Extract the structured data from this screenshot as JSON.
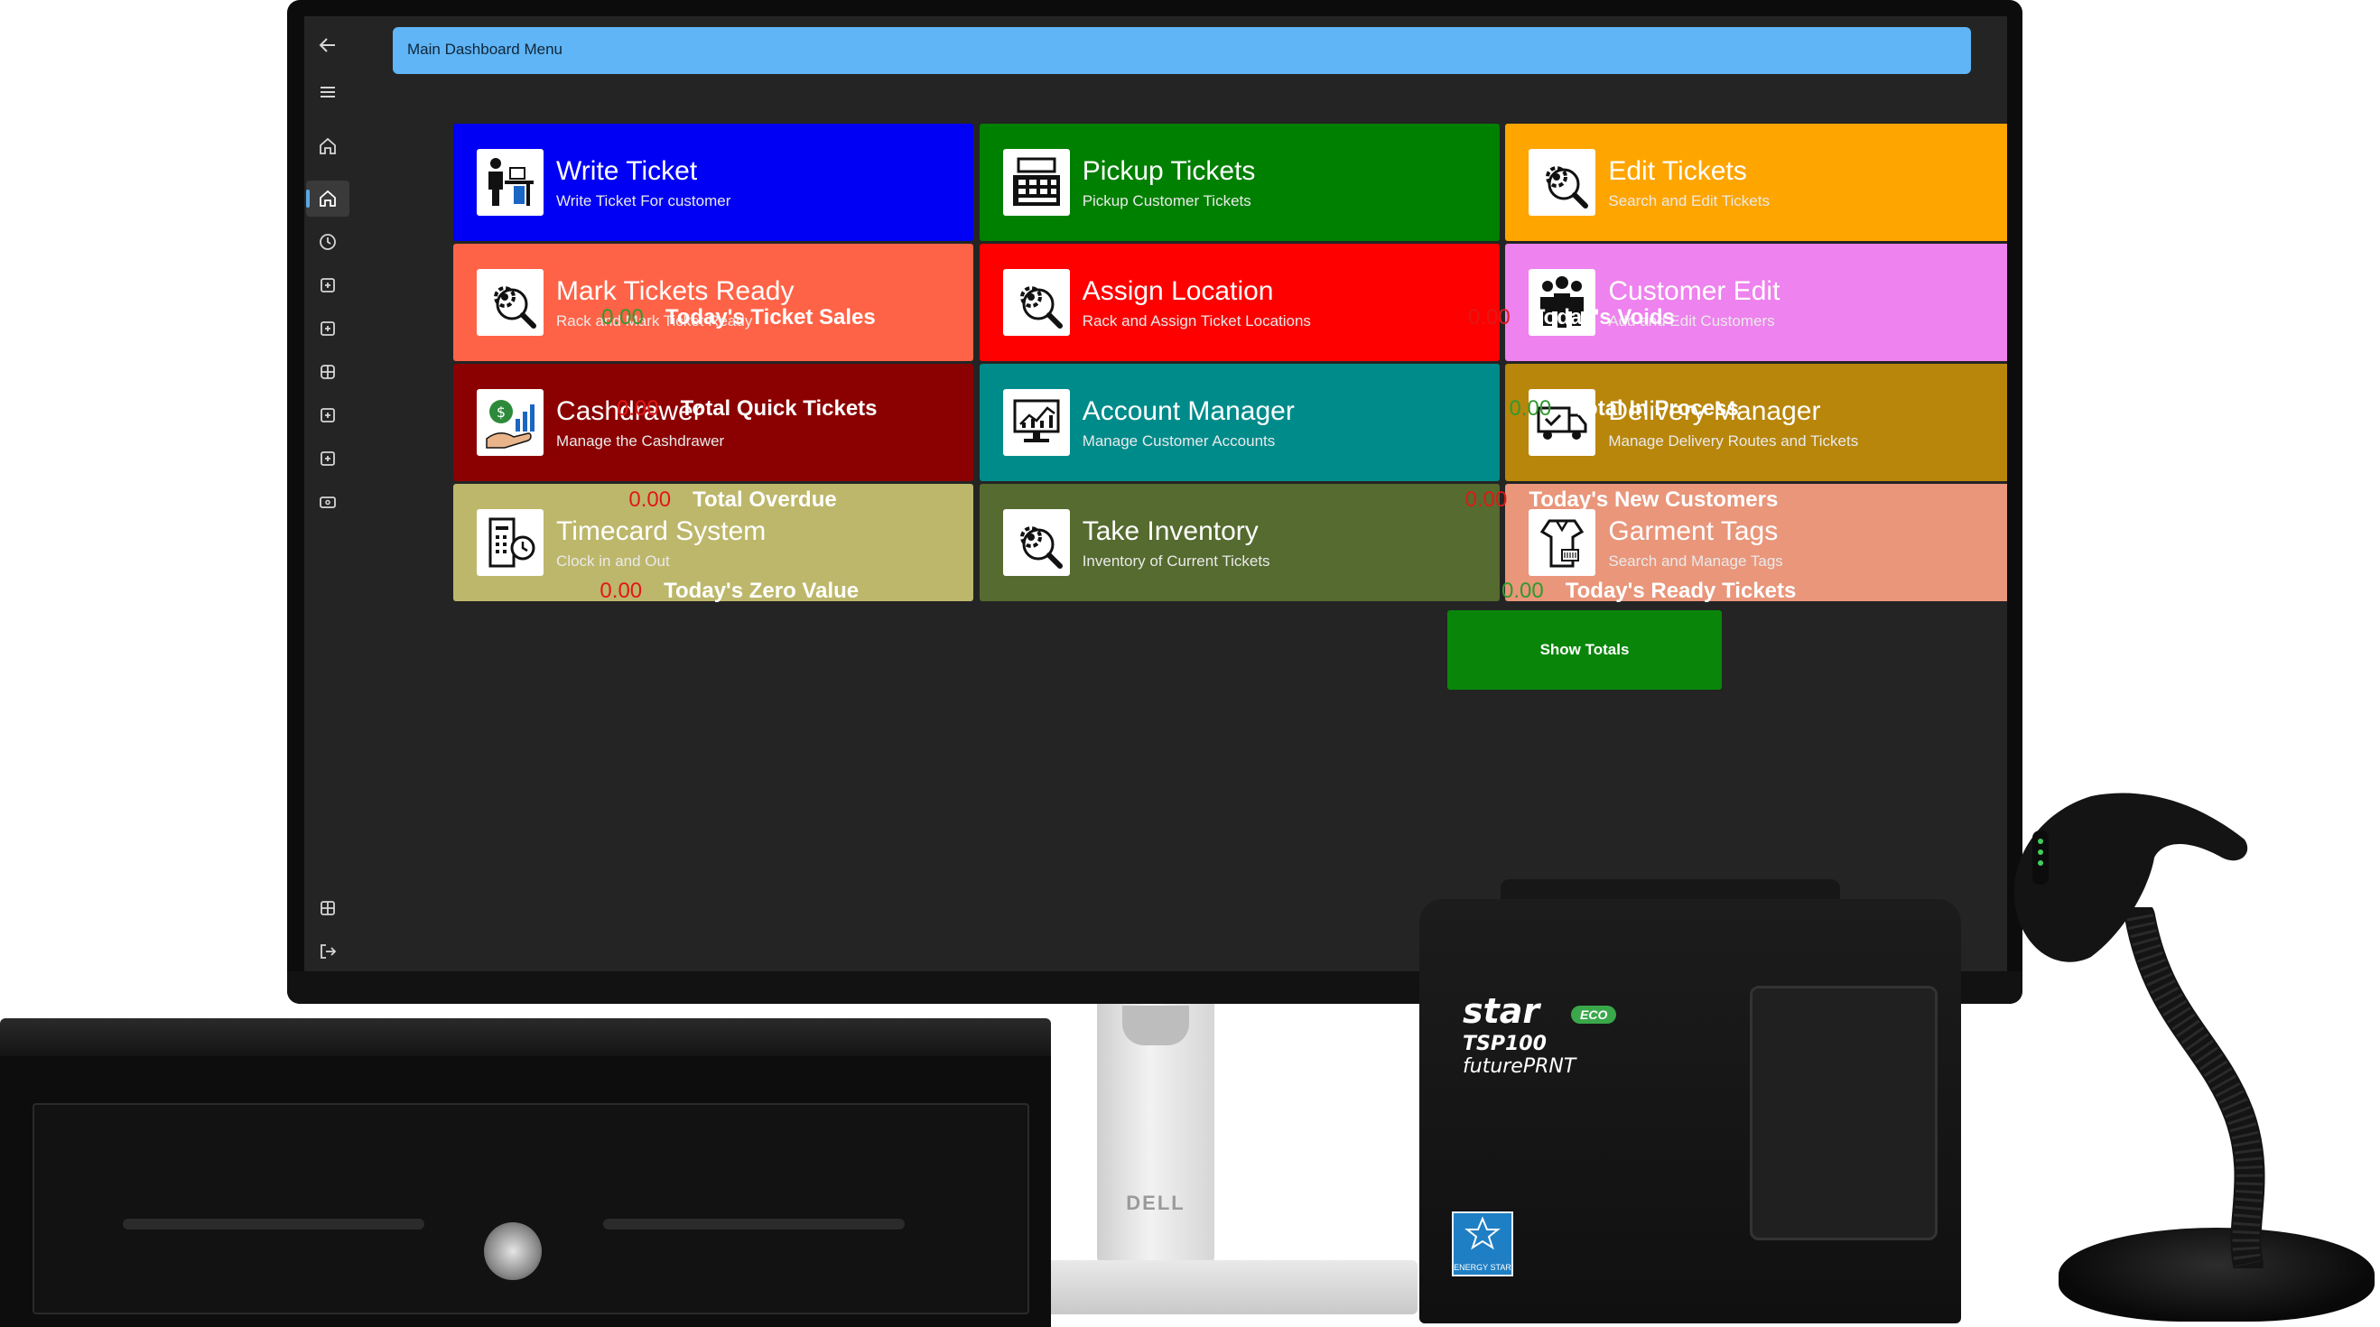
{
  "header": {
    "title": "Main Dashboard Menu"
  },
  "sidebar": {
    "icons": [
      "back-arrow-icon",
      "menu-icon",
      "home-icon",
      "home-icon",
      "clock-icon",
      "add-box-icon",
      "add-box-icon",
      "grid-icon",
      "add-box-icon",
      "add-box-icon",
      "card-icon",
      "grid-icon",
      "sign-out-icon"
    ]
  },
  "tiles": [
    {
      "title": "Write Ticket",
      "subtitle": "Write Ticket For customer",
      "color": "#0000f4",
      "icon": "person-desk-icon"
    },
    {
      "title": "Pickup Tickets",
      "subtitle": "Pickup Customer Tickets",
      "color": "#008000",
      "icon": "cash-register-icon"
    },
    {
      "title": "Edit Tickets",
      "subtitle": "Search and Edit Tickets",
      "color": "#ffa500",
      "icon": "gear-search-icon"
    },
    {
      "title": "Mark Tickets Ready",
      "subtitle": "Rack and Mark Ticket Ready",
      "color": "#ff6347",
      "icon": "gear-search-icon"
    },
    {
      "title": "Assign Location",
      "subtitle": "Rack and Assign Ticket Locations",
      "color": "#fe0000",
      "icon": "gear-search-icon"
    },
    {
      "title": "Customer Edit",
      "subtitle": "Add and Edit Customers",
      "color": "#ee82ee",
      "icon": "people-group-icon"
    },
    {
      "title": "Cashdrawer",
      "subtitle": "Manage the Cashdrawer",
      "color": "#8b0000",
      "icon": "money-hand-icon"
    },
    {
      "title": "Account Manager",
      "subtitle": "Manage Customer Accounts",
      "color": "#008b8b",
      "icon": "chart-monitor-icon"
    },
    {
      "title": "Delivery Manager",
      "subtitle": "Manage Delivery Routes and Tickets",
      "color": "#b8860b",
      "icon": "delivery-truck-icon"
    },
    {
      "title": "Timecard System",
      "subtitle": "Clock in and Out",
      "color": "#bdb76b",
      "icon": "timecard-clock-icon"
    },
    {
      "title": "Take Inventory",
      "subtitle": "Inventory of Current Tickets",
      "color": "#556b2f",
      "icon": "gear-search-icon"
    },
    {
      "title": "Garment Tags",
      "subtitle": "Search and Manage Tags",
      "color": "#e9967a",
      "icon": "garment-tag-icon"
    }
  ],
  "stats": [
    {
      "value": "0.00",
      "label": "Today's Ticket Sales",
      "color": "green"
    },
    {
      "value": "0.00",
      "label": "Today's Voids",
      "color": "red"
    },
    {
      "value": "0.00",
      "label": "Total Quick Tickets",
      "color": "red"
    },
    {
      "value": "0.00",
      "label": "Total In Process",
      "color": "green"
    },
    {
      "value": "0.00",
      "label": "Total Overdue",
      "color": "red"
    },
    {
      "value": "0.00",
      "label": "Today's New Customers",
      "color": "red"
    },
    {
      "value": "0.00",
      "label": "Today's Zero Value",
      "color": "red"
    },
    {
      "value": "0.00",
      "label": "Today's Ready Tickets",
      "color": "green"
    }
  ],
  "show_totals_label": "Show Totals",
  "hardware": {
    "monitor_logo": "DELL",
    "printer_brand": "star",
    "printer_model": "TSP100",
    "printer_series": "futurePRNT",
    "printer_badge": "ECO",
    "energy_label": "ENERGY STAR"
  },
  "colors": {
    "header": "#5fb5f5",
    "background": "#242424",
    "show_totals": "#098509"
  }
}
